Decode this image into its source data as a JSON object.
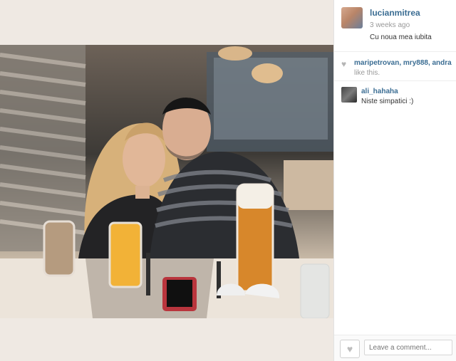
{
  "post": {
    "username": "lucianmitrea",
    "time": "3 weeks ago",
    "caption": "Cu noua mea iubita"
  },
  "likes": {
    "names": "maripetrovan, mry888, andra",
    "text": "like this."
  },
  "comments": [
    {
      "user": "ali_hahaha",
      "text": "Niste simpatici :)"
    }
  ],
  "comment_box": {
    "placeholder": "Leave a comment..."
  },
  "icons": {
    "heart": "heart-icon"
  }
}
